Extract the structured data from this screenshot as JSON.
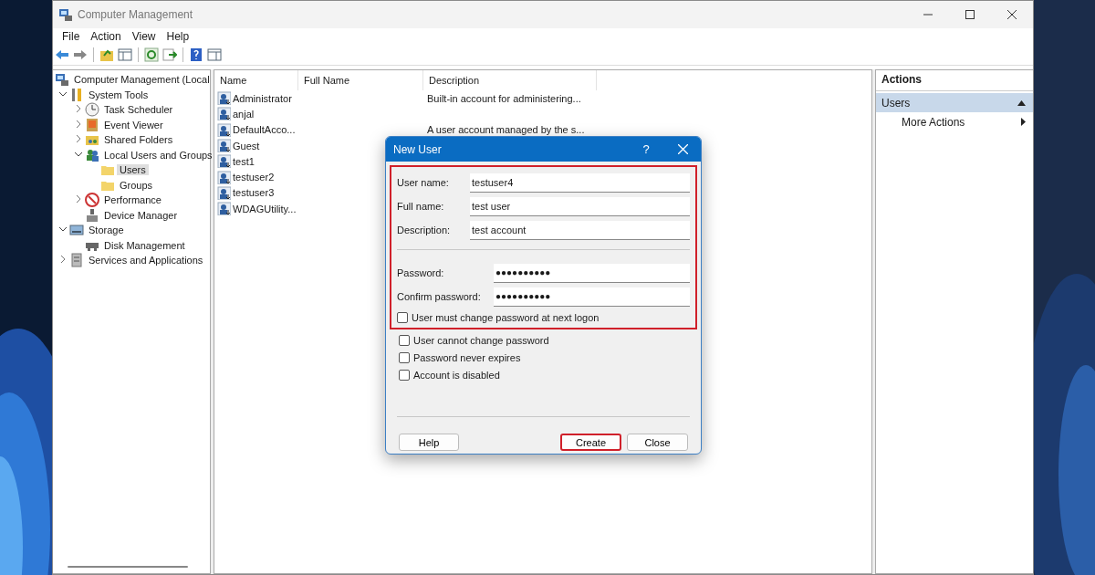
{
  "window": {
    "title": "Computer Management"
  },
  "menu": [
    {
      "label": "File"
    },
    {
      "label": "Action"
    },
    {
      "label": "View"
    },
    {
      "label": "Help"
    }
  ],
  "tree": [
    {
      "label": "Computer Management (Local",
      "selected": false,
      "children": [
        {
          "label": "System Tools",
          "expanded": true,
          "selected": false,
          "children": [
            {
              "label": "Task Scheduler",
              "expanded": false,
              "selected": false
            },
            {
              "label": "Event Viewer",
              "expanded": false,
              "selected": false
            },
            {
              "label": "Shared Folders",
              "expanded": false,
              "selected": false
            },
            {
              "label": "Local Users and Groups",
              "expanded": true,
              "selected": false,
              "children": [
                {
                  "label": "Users",
                  "selected": true
                },
                {
                  "label": "Groups",
                  "selected": false
                }
              ]
            },
            {
              "label": "Performance",
              "expanded": false,
              "selected": false
            },
            {
              "label": "Device Manager",
              "selected": false
            }
          ]
        },
        {
          "label": "Storage",
          "expanded": true,
          "selected": false,
          "children": [
            {
              "label": "Disk Management",
              "selected": false
            }
          ]
        },
        {
          "label": "Services and Applications",
          "expanded": false,
          "selected": false
        }
      ]
    }
  ],
  "list": {
    "columns": [
      "Name",
      "Full Name",
      "Description"
    ],
    "rows": [
      {
        "name": "Administrator",
        "description": "Built-in account for administering..."
      },
      {
        "name": "anjal"
      },
      {
        "name": "DefaultAcco...",
        "description": "A user account managed by the s..."
      },
      {
        "name": "Guest"
      },
      {
        "name": "test1"
      },
      {
        "name": "testuser2"
      },
      {
        "name": "testuser3"
      },
      {
        "name": "WDAGUtility..."
      }
    ]
  },
  "actions": {
    "title": "Actions",
    "section": {
      "label": "Users",
      "expanded": true
    },
    "items": [
      {
        "label": "More Actions"
      }
    ]
  },
  "dialog": {
    "title": "New User",
    "help_glyph": "?",
    "highlighted_section": {
      "fields": [
        {
          "label": "User name:",
          "value": "testuser4",
          "kind": "text"
        },
        {
          "label": "Full name:",
          "value": "test user",
          "kind": "text"
        },
        {
          "label": "Description:",
          "value": "test account",
          "kind": "text"
        },
        {
          "label": "Password:",
          "value": "●●●●●●●●●●",
          "kind": "password"
        },
        {
          "label": "Confirm password:",
          "value": "●●●●●●●●●●",
          "kind": "password"
        }
      ],
      "checkboxes": [
        {
          "label": "User must change password at next logon",
          "checked": false
        }
      ]
    },
    "checkboxes": [
      {
        "label": "User cannot change password",
        "checked": false
      },
      {
        "label": "Password never expires",
        "checked": false
      },
      {
        "label": "Account is disabled",
        "checked": false
      }
    ],
    "buttons": [
      {
        "label": "Help",
        "highlighted": false,
        "kind": "left"
      },
      {
        "label": "Create",
        "highlighted": true,
        "kind": "right"
      },
      {
        "label": "Close",
        "highlighted": false,
        "kind": "right"
      }
    ]
  }
}
